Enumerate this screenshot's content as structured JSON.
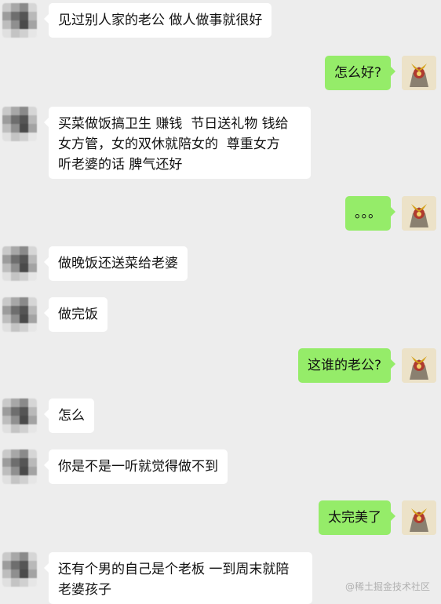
{
  "chat": {
    "messages": [
      {
        "side": "in",
        "text": "见过别人家的老公 做人做事就很好"
      },
      {
        "side": "out",
        "text": "怎么好?"
      },
      {
        "side": "in",
        "text": "买菜做饭搞卫生 赚钱  节日送礼物 钱给\n女方管，女的双休就陪女的  尊重女方\n听老婆的话 脾气还好"
      },
      {
        "side": "out",
        "text": "。。。"
      },
      {
        "side": "in",
        "text": "做晚饭还送菜给老婆"
      },
      {
        "side": "in",
        "text": "做完饭"
      },
      {
        "side": "out",
        "text": "这谁的老公?"
      },
      {
        "side": "in",
        "text": "怎么"
      },
      {
        "side": "in",
        "text": "你是不是一听就觉得做不到"
      },
      {
        "side": "out",
        "text": "太完美了"
      },
      {
        "side": "in",
        "text": "还有个男的自己是个老板 一到周末就陪\n老婆孩子"
      }
    ]
  },
  "watermark": "@稀土掘金技术社区",
  "colors": {
    "background": "#ededed",
    "incoming_bubble": "#ffffff",
    "outgoing_bubble": "#95ec69"
  }
}
